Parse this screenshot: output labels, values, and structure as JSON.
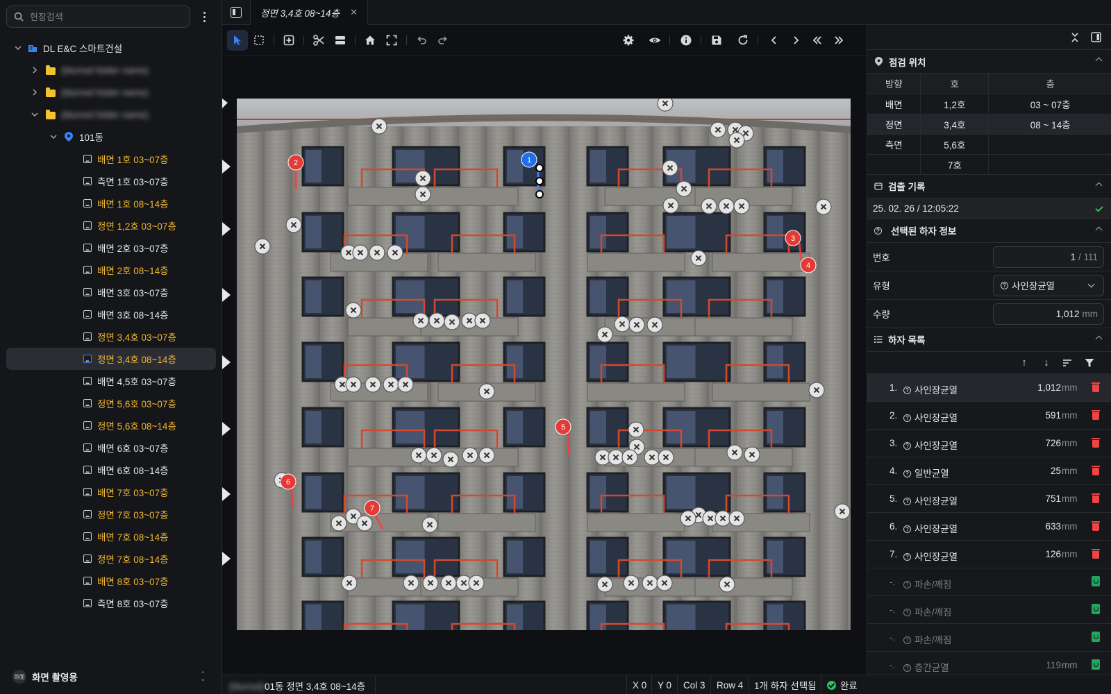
{
  "search": {
    "placeholder": "현장검색"
  },
  "sidebar": {
    "root_label": "DL E&C 스마트건설",
    "folders": [
      {
        "label": "(blurred folder name)"
      },
      {
        "label": "(blurred folder name)"
      },
      {
        "label": "(blurred folder name)"
      }
    ],
    "building_label": "101동",
    "files": [
      {
        "label": "배면 1호 03~07층",
        "highlight": true
      },
      {
        "label": "측면 1호 03~07층",
        "highlight": false
      },
      {
        "label": "배면 1호 08~14층",
        "highlight": true
      },
      {
        "label": "정면 1,2호 03~07층",
        "highlight": true
      },
      {
        "label": "배면 2호 03~07층",
        "highlight": false
      },
      {
        "label": "배면 2호 08~14층",
        "highlight": true
      },
      {
        "label": "배면 3호 03~07층",
        "highlight": false
      },
      {
        "label": "배면 3호 08~14층",
        "highlight": false
      },
      {
        "label": "정면 3,4호 03~07층",
        "highlight": true
      },
      {
        "label": "정면 3,4호 08~14층",
        "highlight": true,
        "selected": true
      },
      {
        "label": "배면 4,5호 03~07층",
        "highlight": false
      },
      {
        "label": "정면 5,6호 03~07층",
        "highlight": true
      },
      {
        "label": "정면 5,6호 08~14층",
        "highlight": true
      },
      {
        "label": "배면 6호 03~07층",
        "highlight": false
      },
      {
        "label": "배면 6호 08~14층",
        "highlight": false
      },
      {
        "label": "배면 7호 03~07층",
        "highlight": true
      },
      {
        "label": "정면 7호 03~07층",
        "highlight": true
      },
      {
        "label": "배면 7호 08~14층",
        "highlight": true
      },
      {
        "label": "정면 7호 08~14층",
        "highlight": true
      },
      {
        "label": "배면 8호 03~07층",
        "highlight": true
      },
      {
        "label": "측면 8호 03~07층",
        "highlight": false
      }
    ],
    "footer": {
      "avatar_text": "화面",
      "name": "화면 촬영용"
    }
  },
  "tab": {
    "title": "정면 3,4호 08~14층"
  },
  "colors": {
    "accent": "#3b82f6",
    "highlight_text": "#f3b632",
    "danger": "#ef4444",
    "success": "#22c55e",
    "marker_red": "#e53935",
    "marker_blue": "#1e6fe8"
  },
  "toolbar": {
    "tools": [
      "select-pointer",
      "marquee-select",
      "add-box",
      "cut",
      "split",
      "home",
      "fit-screen",
      "undo",
      "redo",
      "settings",
      "visibility",
      "info",
      "save",
      "refresh",
      "prev",
      "next",
      "first",
      "last"
    ]
  },
  "canvas": {
    "numbered_markers": [
      "1",
      "2",
      "3",
      "4",
      "5",
      "6",
      "7"
    ]
  },
  "statusbar": {
    "path_blurred": "(blurred)",
    "path": "01동 정면 3,4호 08~14층",
    "x": "X 0",
    "y": "Y 0",
    "col": "Col 3",
    "row": "Row 4",
    "selection": "1개 하자 선택됨",
    "status": "완료"
  },
  "panel": {
    "location": {
      "title": "점검 위치",
      "headers": [
        "방향",
        "호",
        "층"
      ],
      "rows": [
        [
          "배면",
          "1,2호",
          "03 ~ 07층"
        ],
        [
          "정면",
          "3,4호",
          "08 ~ 14층"
        ],
        [
          "측면",
          "5,6호",
          ""
        ],
        [
          "",
          "7호",
          ""
        ]
      ],
      "selected_row": 1
    },
    "records": {
      "title": "검출 기록",
      "entry": "25. 02. 26 / 12:05:22"
    },
    "selected_defect": {
      "title": "선택된 하자 정보",
      "number_label": "번호",
      "number_value": "1",
      "number_total": "/ 111",
      "type_label": "유형",
      "type_value": "사인장균열",
      "qty_label": "수량",
      "qty_value": "1,012",
      "qty_unit": "mm"
    },
    "defect_list": {
      "title": "하자 목록",
      "items": [
        {
          "num": "1.",
          "type": "사인장균열",
          "value": "1,012",
          "unit": "mm",
          "active": true
        },
        {
          "num": "2.",
          "type": "사인장균열",
          "value": "591",
          "unit": "mm",
          "active": true
        },
        {
          "num": "3.",
          "type": "사인장균열",
          "value": "726",
          "unit": "mm",
          "active": true
        },
        {
          "num": "4.",
          "type": "일반균열",
          "value": "25",
          "unit": "mm",
          "active": true
        },
        {
          "num": "5.",
          "type": "사인장균열",
          "value": "751",
          "unit": "mm",
          "active": true
        },
        {
          "num": "6.",
          "type": "사인장균열",
          "value": "633",
          "unit": "mm",
          "active": true
        },
        {
          "num": "7.",
          "type": "사인장균열",
          "value": "126",
          "unit": "mm",
          "active": true
        },
        {
          "num": "-.",
          "type": "파손/깨짐",
          "value": "",
          "unit": "",
          "active": false
        },
        {
          "num": "-.",
          "type": "파손/깨짐",
          "value": "",
          "unit": "",
          "active": false
        },
        {
          "num": "-.",
          "type": "파손/깨짐",
          "value": "",
          "unit": "",
          "active": false
        },
        {
          "num": "-.",
          "type": "층간균열",
          "value": "119",
          "unit": "mm",
          "active": false
        },
        {
          "num": "-.",
          "type": "파손/깨짐",
          "value": "",
          "unit": "",
          "active": false
        }
      ]
    }
  }
}
